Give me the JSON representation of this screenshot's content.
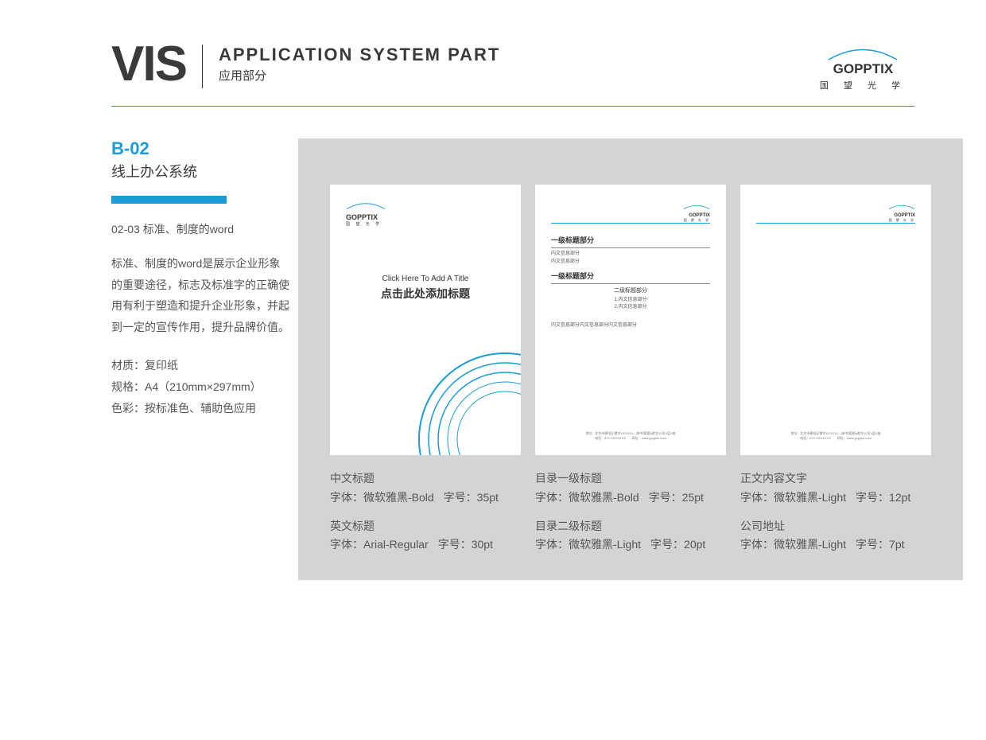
{
  "header": {
    "vis": "VIS",
    "title_en": "APPLICATION SYSTEM PART",
    "title_cn": "应用部分"
  },
  "logo": {
    "name": "GOPPTIX",
    "sub": "国 望 光 学"
  },
  "section": {
    "code": "B-02",
    "name": "线上办公系统",
    "spec_title": "02-03  标准、制度的word",
    "description": "标准、制度的word是展示企业形象的重要途径，标志及标准字的正确使用有利于塑造和提升企业形象，并起到一定的宣传作用，提升品牌价值。",
    "material": "材质：复印纸",
    "format": "规格：A4（210mm×297mm）",
    "color": "色彩：按标准色、辅助色应用"
  },
  "page1": {
    "en": "Click Here To Add A Title",
    "cn": "点击此处添加标题"
  },
  "page2": {
    "h1a": "一级标题部分",
    "txt1": "内文信息部分",
    "txt2": "内文信息部分",
    "h1b": "一级标题部分",
    "h2": "二级标题部分",
    "item1": "1.内文信息部分",
    "item2": "2.内文信息部分",
    "body": "内文信息部分内文信息部分内文信息部分"
  },
  "footer": {
    "addr": "地址：北京市朝阳区望京XXXXXX—座中国国际航空公司X层X座",
    "contact": "电话：872-XXXXXXX　　网址：www.gopptix.com"
  },
  "captions": [
    {
      "groups": [
        {
          "title": "中文标题",
          "font": "字体：微软雅黑-Bold",
          "size": "字号：35pt"
        },
        {
          "title": "英文标题",
          "font": "字体：Arial-Regular",
          "size": "字号：30pt"
        }
      ]
    },
    {
      "groups": [
        {
          "title": "目录一级标题",
          "font": "字体：微软雅黑-Bold",
          "size": "字号：25pt"
        },
        {
          "title": "目录二级标题",
          "font": "字体：微软雅黑-Light",
          "size": "字号：20pt"
        }
      ]
    },
    {
      "groups": [
        {
          "title": "正文内容文字",
          "font": "字体：微软雅黑-Light",
          "size": "字号：12pt"
        },
        {
          "title": "公司地址",
          "font": "字体：微软雅黑-Light",
          "size": "字号：7pt"
        }
      ]
    }
  ]
}
